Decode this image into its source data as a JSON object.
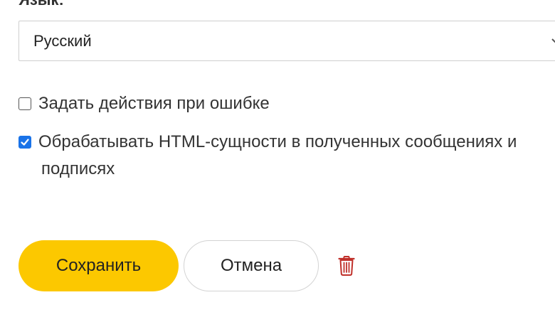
{
  "language": {
    "label": "Язык:",
    "selected": "Русский",
    "caret_icon": "chevron-down-icon"
  },
  "options": [
    {
      "label": "Задать действия при ошибке",
      "checked": false
    },
    {
      "label_line1": "Обрабатывать HTML-сущности в полученных сообщениях и",
      "label_line2": "подписях",
      "checked": true
    }
  ],
  "actions": {
    "save_label": "Сохранить",
    "cancel_label": "Отмена",
    "delete_icon": "trash-icon"
  },
  "colors": {
    "accent": "#fcc800",
    "checkbox_checked": "#1a73e8",
    "delete_icon": "#c0312b"
  }
}
